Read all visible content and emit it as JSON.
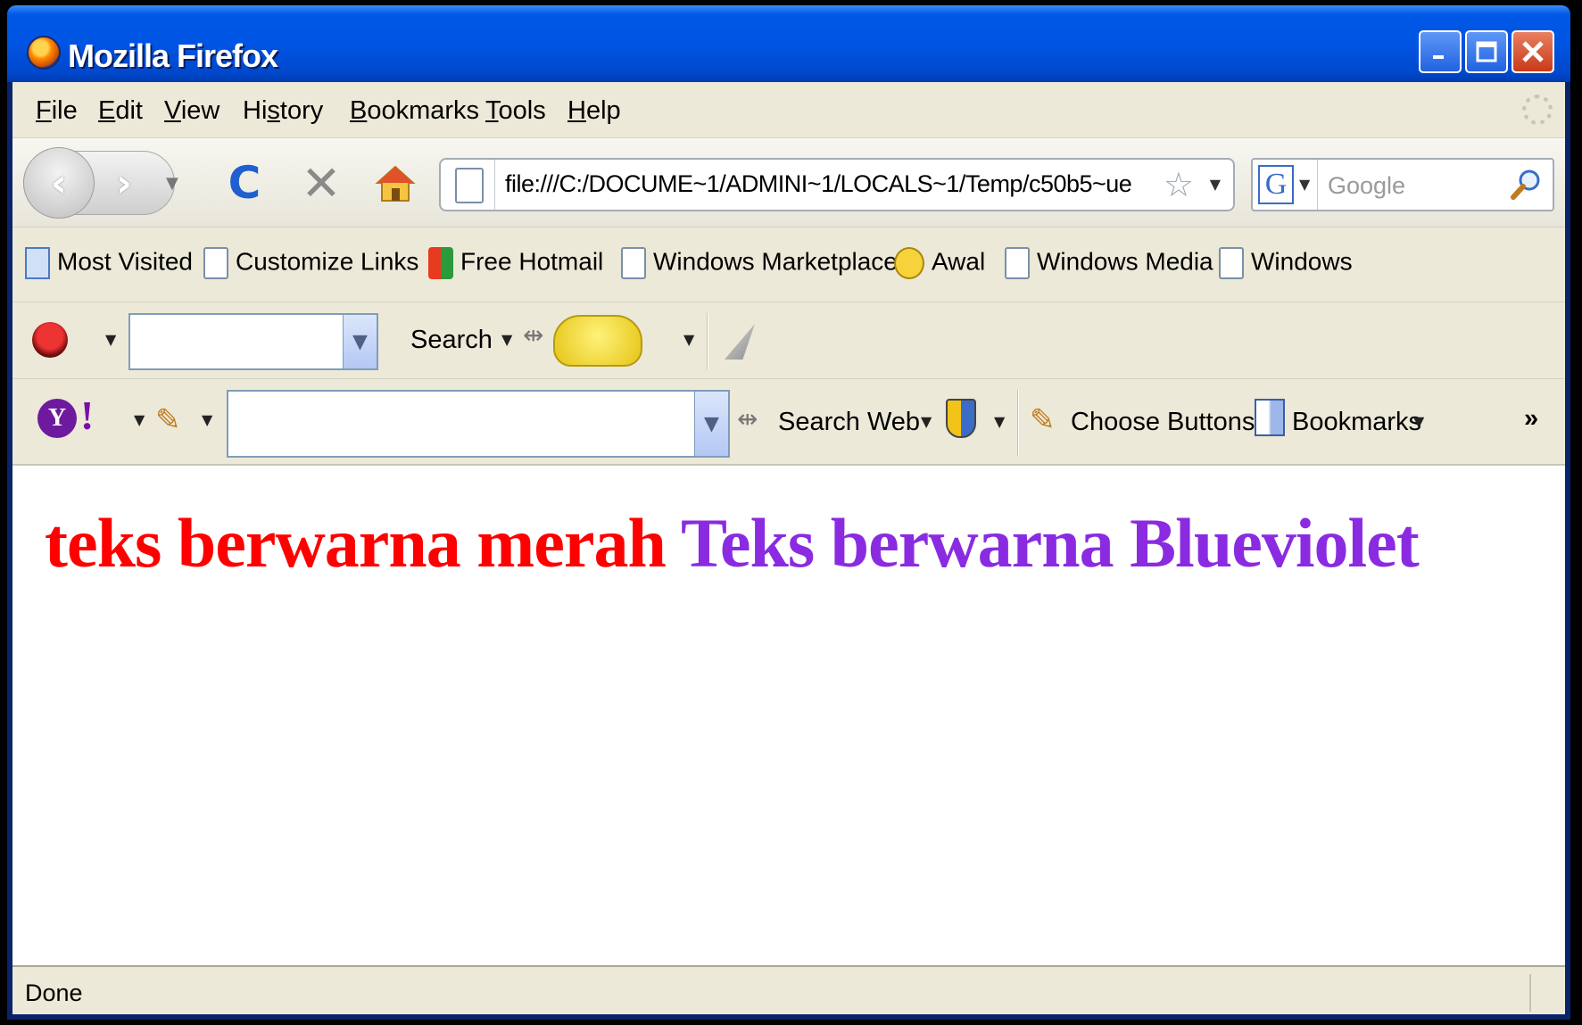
{
  "window": {
    "title": "Mozilla Firefox",
    "buttons": [
      "minimize",
      "maximize",
      "close"
    ]
  },
  "menu": {
    "items": [
      {
        "label": "File",
        "u": "F",
        "rest": "ile"
      },
      {
        "label": "Edit",
        "u": "E",
        "rest": "dit"
      },
      {
        "label": "View",
        "u": "V",
        "rest": "iew"
      },
      {
        "label": "History",
        "pre": "Hi",
        "u": "s",
        "rest": "tory"
      },
      {
        "label": "Bookmarks",
        "u": "B",
        "rest": "ookmarks"
      },
      {
        "label": "Tools",
        "u": "T",
        "rest": "ools"
      },
      {
        "label": "Help",
        "u": "H",
        "rest": "elp"
      }
    ]
  },
  "nav": {
    "url": "file:///C:/DOCUME~1/ADMINI~1/LOCALS~1/Temp/c50b5~ue",
    "search_placeholder": "Google",
    "search_engine_letter": "G"
  },
  "bookmarks": {
    "items": [
      "Most Visited",
      "Customize Links",
      "Free Hotmail",
      "Windows Marketplace",
      "Awal",
      "Windows Media",
      "Windows"
    ]
  },
  "toolbar1": {
    "search_label": "Search"
  },
  "toolbar2": {
    "search_web_label": "Search Web",
    "choose_buttons_label": "Choose Buttons",
    "bookmarks_label": "Bookmarks",
    "overflow_label": "»"
  },
  "content": {
    "red_text": "teks berwarna merah",
    "blueviolet_text": "Teks berwarna Blueviolet",
    "red_color": "#ff0000",
    "blueviolet_color": "#8a2be2"
  },
  "status": {
    "text": "Done"
  }
}
